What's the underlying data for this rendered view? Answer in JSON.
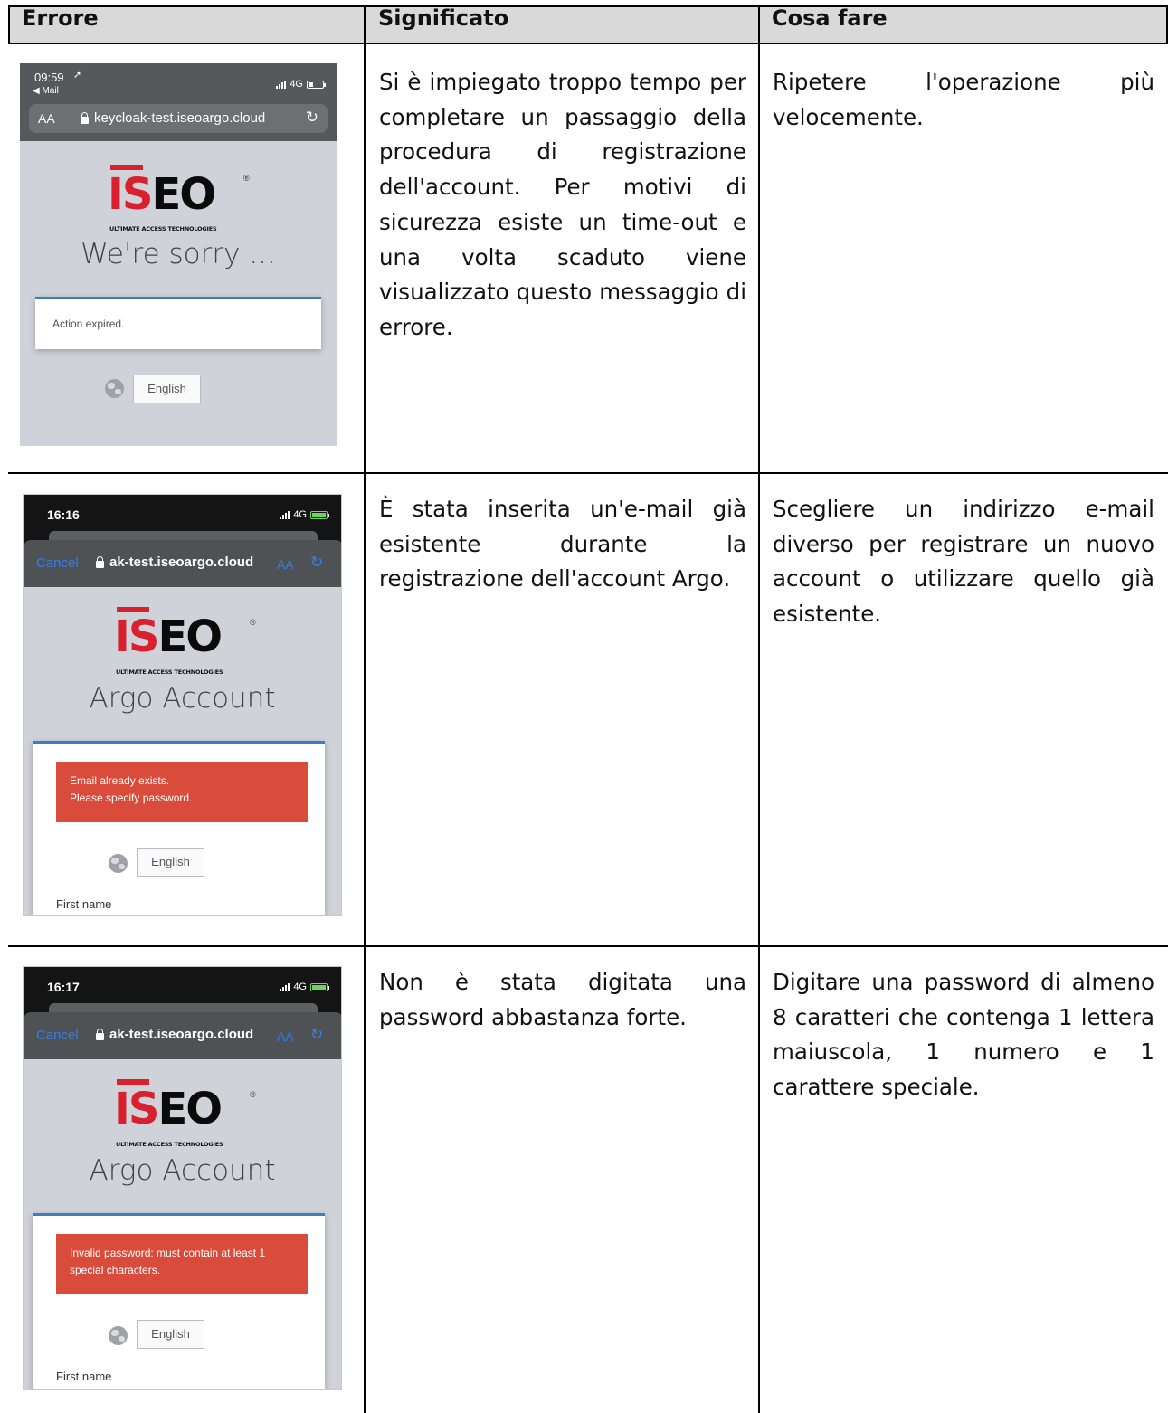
{
  "table": {
    "headers": [
      "Errore",
      "Significato",
      "Cosa fare"
    ],
    "rows": [
      {
        "meaning": "Si è impiegato troppo tempo per completare un passaggio della procedura di registrazione dell'account. Per motivi di sicurezza esiste un time-out e una volta scaduto viene visualizzato questo messaggio di errore.",
        "action": "Ripetere l'operazione più velocemente.",
        "screenshot": {
          "time": "09:59",
          "back_label": "◀ Mail",
          "network": "4G",
          "text_size_label": "AA",
          "url": "keycloak-test.iseoargo.cloud",
          "logo_word": "ISEO",
          "logo_tagline": "ULTIMATE ACCESS TECHNOLOGIES",
          "heading": "We're sorry ...",
          "message": "Action expired.",
          "language": "English"
        }
      },
      {
        "meaning": "È stata inserita un'e-mail già esistente durante la registrazione dell'account Argo.",
        "action": "Scegliere un indirizzo e-mail diverso per registrare un nuovo account o utilizzare quello già esistente.",
        "screenshot": {
          "time": "16:16",
          "network": "4G",
          "cancel_label": "Cancel",
          "url": "ak-test.iseoargo.cloud",
          "text_size_label": "AA",
          "logo_word": "ISEO",
          "logo_tagline": "ULTIMATE ACCESS TECHNOLOGIES",
          "heading": "Argo Account",
          "alert_line1": "Email already exists.",
          "alert_line2": "Please specify password.",
          "language": "English",
          "field_label": "First name"
        }
      },
      {
        "meaning": "Non è stata digitata una password abbastanza forte.",
        "action": "Digitare una password di almeno 8 caratteri che contenga 1 lettera maiuscola, 1 numero e 1 carattere speciale.",
        "screenshot": {
          "time": "16:17",
          "network": "4G",
          "cancel_label": "Cancel",
          "url": "ak-test.iseoargo.cloud",
          "text_size_label": "AA",
          "logo_word": "ISEO",
          "logo_tagline": "ULTIMATE ACCESS TECHNOLOGIES",
          "heading": "Argo Account",
          "alert_line1": "Invalid password: must contain at least 1",
          "alert_line2": "special characters.",
          "language": "English",
          "field_label": "First name"
        }
      }
    ]
  },
  "colors": {
    "header_bg": "#d9d9d9",
    "iseo_red": "#d8202e",
    "alert_red": "#d94b3a",
    "card_accent": "#3a7dc4",
    "ios_blue": "#2f7ff4"
  },
  "icons": [
    "lock-icon",
    "reload-icon",
    "globe-icon",
    "signal-icon",
    "battery-icon",
    "location-arrow-icon"
  ]
}
